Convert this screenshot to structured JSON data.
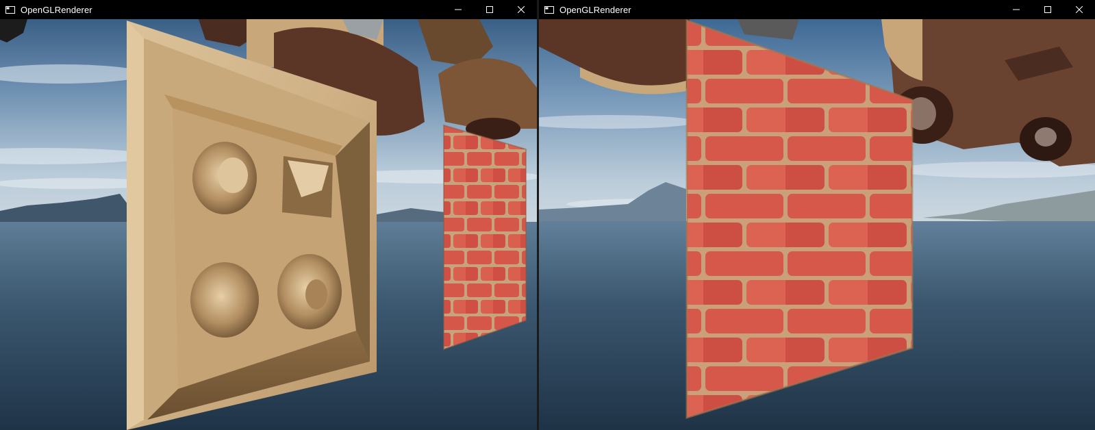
{
  "windows": [
    {
      "title": "OpenGLRenderer",
      "scene": "Wooden panel with carved holes in front of a red brick wall, sky and water background"
    },
    {
      "title": "OpenGLRenderer",
      "scene": "Red brick wall panel close-up, leather bags floating above, sky and water background"
    }
  ],
  "caption_buttons": {
    "minimize": "minimize-icon",
    "maximize": "maximize-icon",
    "close": "close-icon"
  },
  "colors": {
    "titlebar": "#000000",
    "title_text": "#ffffff",
    "sky_top": "#3e6894",
    "sky_horizon": "#b7c9d8",
    "water": "#2e465c",
    "wood": "#d2b58c",
    "brick": "#d4574a",
    "mortar": "#c7a27c",
    "leather": "#5b3526"
  }
}
